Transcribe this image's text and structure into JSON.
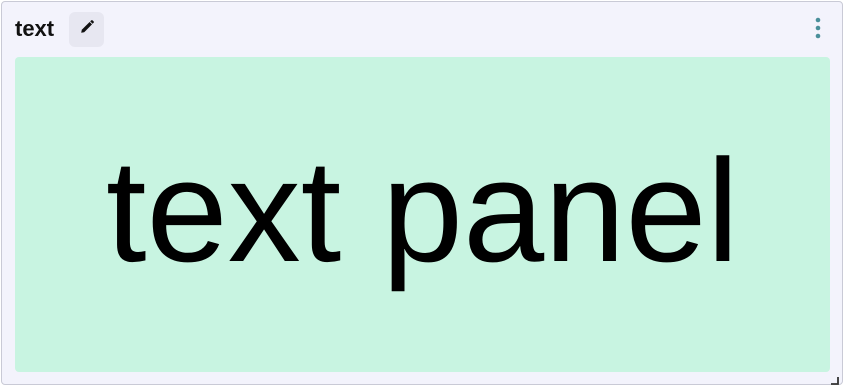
{
  "panel": {
    "title": "text",
    "content_text": "text panel",
    "content_background": "#c8f4e1",
    "edit_icon": "pencil-icon",
    "menu_icon": "kebab-menu-icon",
    "resize_icon": "resize-handle-icon"
  },
  "colors": {
    "card_background": "#f3f3fc",
    "menu_accent": "#4a8f9a",
    "content_background": "#c8f4e1"
  }
}
